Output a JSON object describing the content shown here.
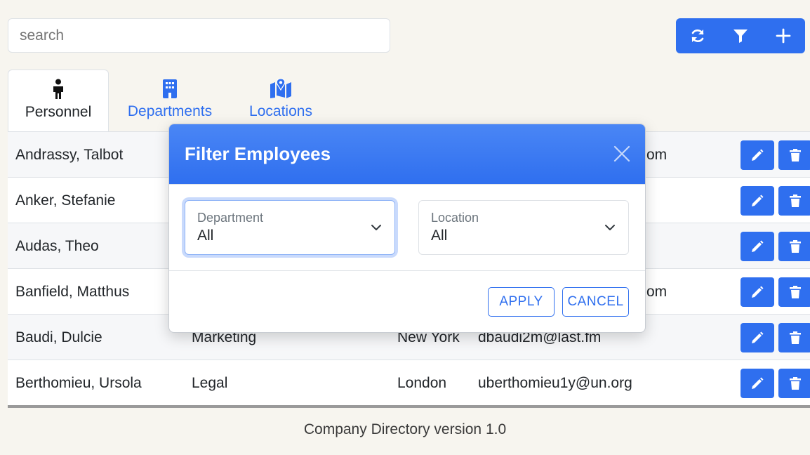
{
  "search": {
    "placeholder": "search"
  },
  "toolbar": {
    "buttons": [
      {
        "icon": "refresh-icon"
      },
      {
        "icon": "filter-icon"
      },
      {
        "icon": "plus-icon"
      }
    ]
  },
  "tabs": [
    {
      "label": "Personnel",
      "icon": "person-icon",
      "active": true
    },
    {
      "label": "Departments",
      "icon": "building-icon",
      "active": false
    },
    {
      "label": "Locations",
      "icon": "map-location-icon",
      "active": false
    }
  ],
  "rows": [
    {
      "name": "Andrassy, Talbot",
      "department": "",
      "location": "",
      "email": "om"
    },
    {
      "name": "Anker, Stefanie",
      "department": "",
      "location": "",
      "email": ""
    },
    {
      "name": "Audas, Theo",
      "department": "",
      "location": "",
      "email": ""
    },
    {
      "name": "Banfield, Matthus",
      "department": "",
      "location": "",
      "email": "om"
    },
    {
      "name": "Baudi, Dulcie",
      "department": "Marketing",
      "location": "New York",
      "email": "dbaudi2m@last.fm"
    },
    {
      "name": "Berthomieu, Ursola",
      "department": "Legal",
      "location": "London",
      "email": "uberthomieu1y@un.org"
    }
  ],
  "footer": {
    "text": "Company Directory version 1.0"
  },
  "modal": {
    "title": "Filter Employees",
    "department": {
      "label": "Department",
      "value": "All"
    },
    "location": {
      "label": "Location",
      "value": "All"
    },
    "apply_label": "APPLY",
    "cancel_label": "CANCEL"
  },
  "colors": {
    "accent": "#2f6fef",
    "background": "#f7f5ef"
  }
}
